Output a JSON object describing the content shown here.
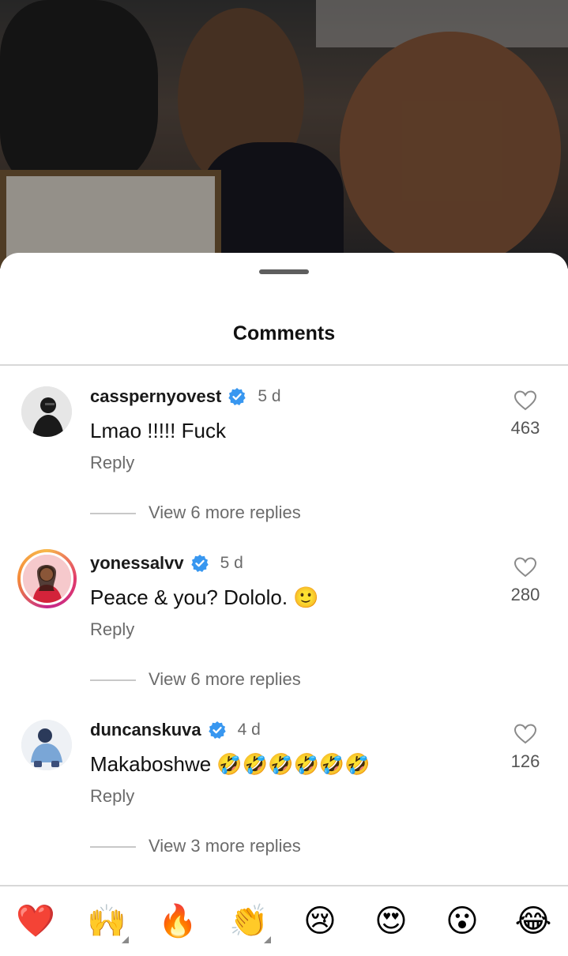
{
  "sheet": {
    "title": "Comments"
  },
  "comments": [
    {
      "username": "casspernyovest",
      "time": "5 d",
      "text": "Lmao !!!!! Fuck",
      "reply_label": "Reply",
      "view_replies": "View 6 more replies",
      "likes": "463"
    },
    {
      "username": "yonessalvv",
      "time": "5 d",
      "text": "Peace & you? Dololo. 🙂",
      "reply_label": "Reply",
      "view_replies": "View 6 more replies",
      "likes": "280"
    },
    {
      "username": "duncanskuva",
      "time": "4 d",
      "text": "Makaboshwe 🤣🤣🤣🤣🤣🤣",
      "reply_label": "Reply",
      "view_replies": "View 3 more replies",
      "likes": "126"
    }
  ],
  "emoji_bar": [
    "❤️",
    "🙌",
    "🔥",
    "👏",
    "😢",
    "😍",
    "😮",
    "😂"
  ],
  "colors": {
    "verified": "#3897f0",
    "muted_text": "#6b6b6b"
  }
}
